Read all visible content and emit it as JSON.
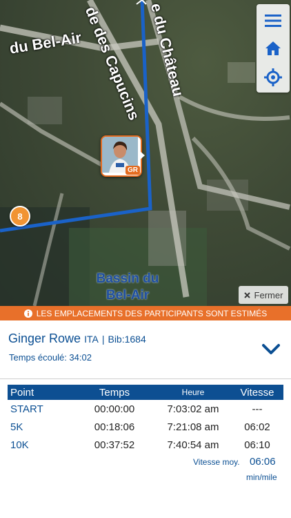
{
  "map": {
    "streets": {
      "bel_air": "du Bel-Air",
      "capucins": "de des Capucins",
      "chateau": "e du Château"
    },
    "lake_label": "Bassin du Bel-Air",
    "km_marker": "8",
    "runner_badge": "GR",
    "close_label": "Fermer",
    "controls": [
      "menu-icon",
      "home-icon",
      "locate-icon"
    ]
  },
  "banner": {
    "text": "LES EMPLACEMENTS DES PARTICIPANTS SONT ESTIMÉS",
    "icon": "info-icon"
  },
  "runner": {
    "name": "Ginger Rowe",
    "nationality": "ITA",
    "separator": "|",
    "bib": "Bib:1684",
    "elapsed": "Temps écoulé: 34:02"
  },
  "splits": {
    "headers": {
      "point": "Point",
      "time": "Temps",
      "hour": "Heure",
      "speed": "Vitesse"
    },
    "rows": [
      {
        "point": "START",
        "time": "00:00:00",
        "hour": "7:03:02 am",
        "speed": "---"
      },
      {
        "point": "5K",
        "time": "00:18:06",
        "hour": "7:21:08 am",
        "speed": "06:02"
      },
      {
        "point": "10K",
        "time": "00:37:52",
        "hour": "7:40:54 am",
        "speed": "06:10"
      }
    ],
    "avg_label": "Vitesse moy.",
    "avg_value": "06:06",
    "avg_unit": "min/mile"
  },
  "colors": {
    "route": "#1a62c8",
    "banner": "#e8702a",
    "header": "#0d4f92",
    "text_blue": "#0b4f93",
    "marker_orange": "#f19433"
  }
}
